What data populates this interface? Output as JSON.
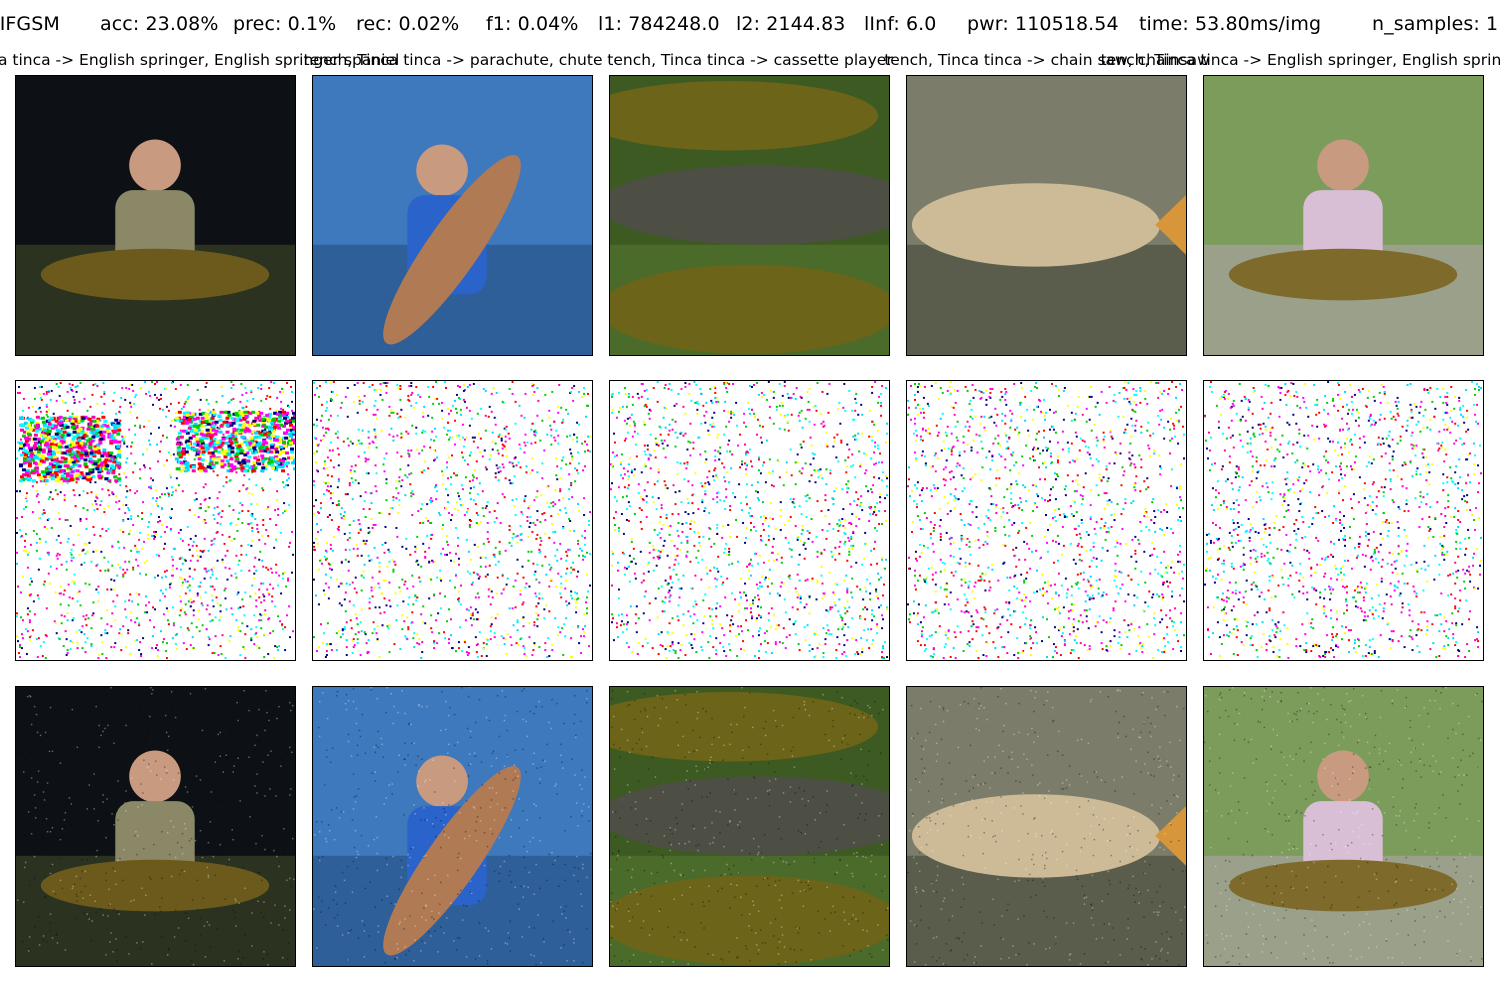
{
  "header": {
    "attack": "IIFGSM",
    "acc": "acc: 23.08%",
    "prec": "prec: 0.1%",
    "rec": "rec: 0.02%",
    "f1": "f1: 0.04%",
    "l1": "l1: 784248.0",
    "l2": "l2: 2144.83",
    "linf": "lInf: 6.0",
    "pwr": "pwr: 110518.54",
    "time": "time: 53.80ms/img",
    "n_samples": "n_samples: 1"
  },
  "captions": [
    "tench, Tinca tinca -> English springer, English springer spaniel",
    "tench, Tinca tinca -> parachute, chute",
    "tench, Tinca tinca -> cassette player",
    "tench, Tinca tinca -> chain saw, chainsaw",
    "tench, Tinca tinca -> English springer, English springer spaniel"
  ],
  "rows": [
    "original",
    "perturbation",
    "adversarial"
  ],
  "scenes": [
    {
      "desc": "man with hat holding tench at night",
      "bg": "#0d1015",
      "ground": "#2b3320",
      "fish": "#6b5a1c"
    },
    {
      "desc": "man on boat holding large fish over sea",
      "bg": "#3e78bd",
      "ground": "#2f5f99",
      "fish": "#b07a55"
    },
    {
      "desc": "three tench on grass",
      "bg": "#3d5a22",
      "ground": "#4b6b2a",
      "fish": "#6c6418"
    },
    {
      "desc": "fish lying on net",
      "bg": "#7b7d6a",
      "ground": "#5a5c4c",
      "fish": "#cdbb98"
    },
    {
      "desc": "boy holding carp by lake",
      "bg": "#7c9c5c",
      "ground": "#9aa08a",
      "fish": "#7e6a2a"
    }
  ]
}
